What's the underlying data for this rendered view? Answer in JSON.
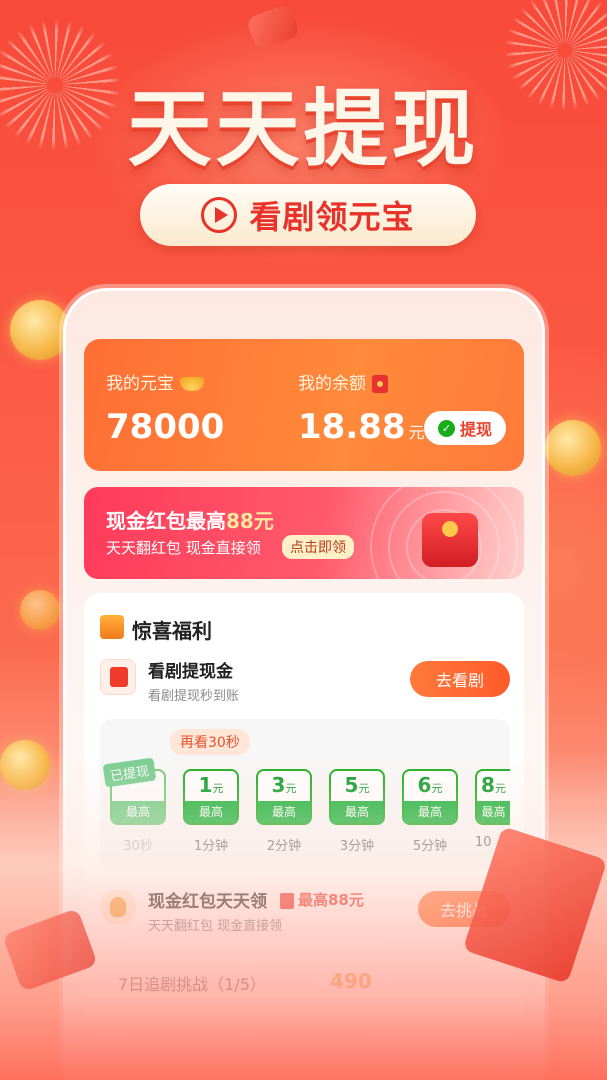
{
  "banner": {
    "title": "天天提现",
    "pill_label": "看剧领元宝"
  },
  "account": {
    "ingots_label": "我的元宝",
    "ingots_value": "78000",
    "balance_label": "我的余额",
    "balance_value": "18.88",
    "balance_unit": "元",
    "withdraw_label": "提现"
  },
  "promo": {
    "title_prefix": "现金红包最高",
    "title_amount": "88元",
    "subtitle": "天天翻红包 现金直接领",
    "button_label": "点击即领"
  },
  "benefits": {
    "title": "惊喜福利",
    "task1": {
      "title": "看剧提现金",
      "subtitle": "看剧提现秒到账",
      "button": "去看剧"
    },
    "progress": {
      "hint": "再看30秒",
      "done_label": "已提现",
      "steps": [
        {
          "amount": "",
          "unit": "",
          "tag": "最高",
          "time": "30秒"
        },
        {
          "amount": "1",
          "unit": "元",
          "tag": "最高",
          "time": "1分钟"
        },
        {
          "amount": "3",
          "unit": "元",
          "tag": "最高",
          "time": "2分钟"
        },
        {
          "amount": "5",
          "unit": "元",
          "tag": "最高",
          "time": "3分钟"
        },
        {
          "amount": "6",
          "unit": "元",
          "tag": "最高",
          "time": "5分钟"
        },
        {
          "amount": "8",
          "unit": "元",
          "tag": "最高",
          "time": "10"
        }
      ]
    },
    "task2": {
      "title": "现金红包天天领",
      "badge": "最高88元",
      "subtitle": "天天翻红包 现金直接领",
      "button": "去挑战"
    },
    "task3": {
      "title": "7日追剧挑战（1/5）",
      "reward": "490"
    }
  },
  "colors": {
    "accent": "#ff6e34",
    "brand_red": "#e8322a",
    "wechat_green": "#1aad19"
  }
}
